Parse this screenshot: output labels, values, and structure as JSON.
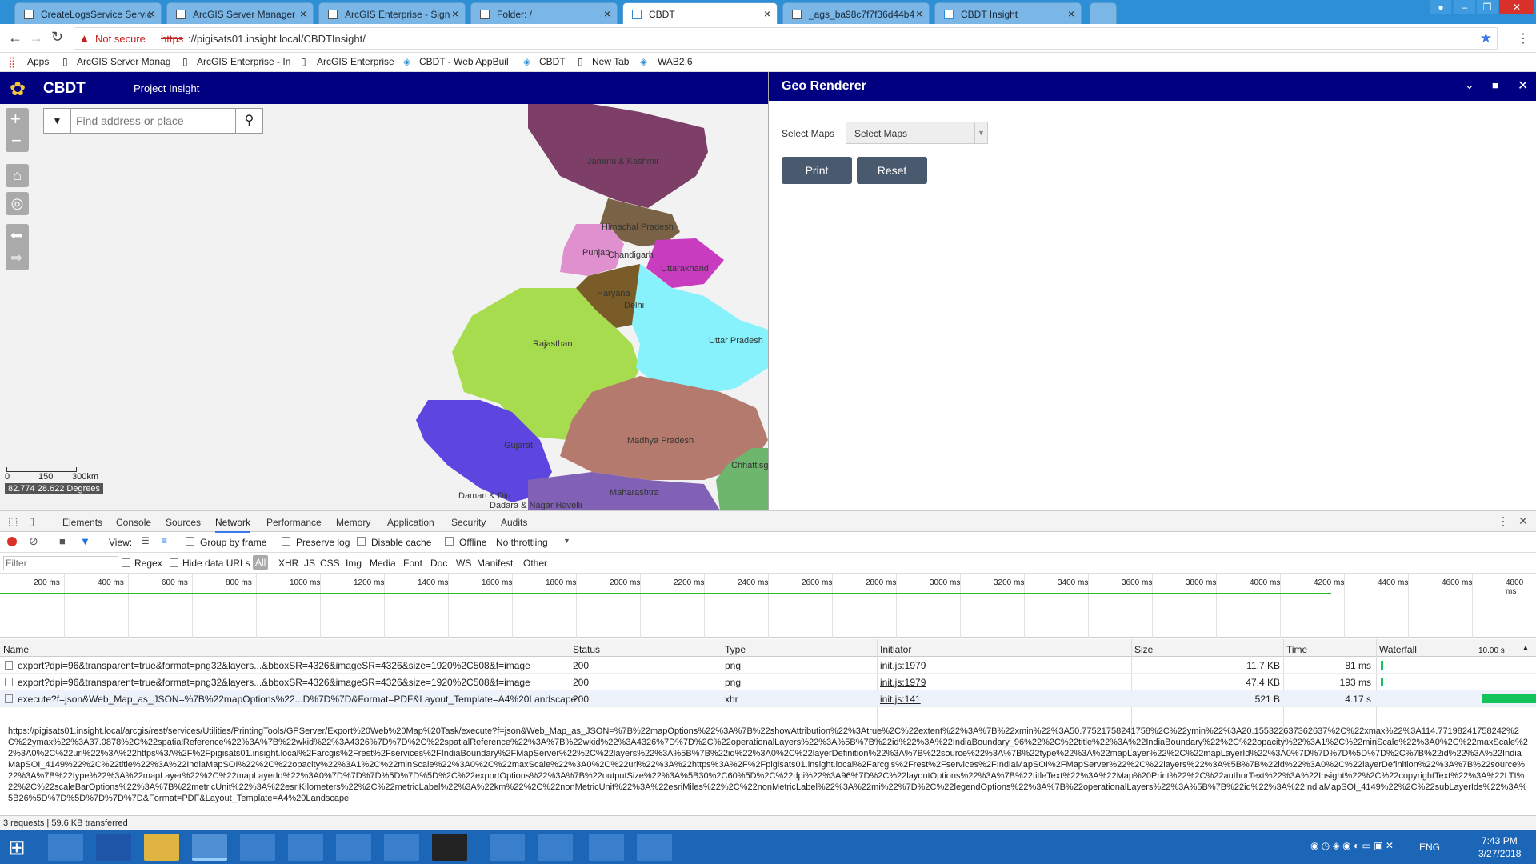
{
  "browser": {
    "tabs": [
      {
        "title": "CreateLogsService Servic"
      },
      {
        "title": "ArcGIS Server Manager"
      },
      {
        "title": "ArcGIS Enterprise - Sign"
      },
      {
        "title": "Folder: /"
      },
      {
        "title": "CBDT"
      },
      {
        "title": "_ags_ba98c7f7f36d44b4"
      },
      {
        "title": "CBDT Insight"
      }
    ],
    "not_secure": "Not secure",
    "url_scheme": "https",
    "url_rest": "://pigisats01.insight.local/CBDTInsight/",
    "bookmarks": [
      "Apps",
      "ArcGIS Server Manag",
      "ArcGIS Enterprise - In",
      "ArcGIS Enterprise",
      "CBDT - Web AppBuil",
      "CBDT",
      "New Tab",
      "WAB2.6"
    ]
  },
  "app": {
    "title": "CBDT",
    "subtitle": "Project Insight",
    "search_placeholder": "Find address or place",
    "scale_labels": [
      "0",
      "150",
      "300km"
    ],
    "coords": "82.774 28.622 Degrees",
    "states": [
      "Jammu & Kashmir",
      "Himachal Pradesh",
      "Punjab",
      "Chandigarh",
      "Uttarakhand",
      "Haryana",
      "Delhi",
      "Rajasthan",
      "Uttar Pradesh",
      "Gujarat",
      "Madhya Pradesh",
      "Chhattisg",
      "Maharashtra",
      "Daman & Diu",
      "Dadara & Nagar Havelli"
    ]
  },
  "panel": {
    "title": "Geo Renderer",
    "select_label": "Select Maps",
    "select_value": "Select Maps",
    "print": "Print",
    "reset": "Reset"
  },
  "devtools": {
    "tabs": [
      "Elements",
      "Console",
      "Sources",
      "Network",
      "Performance",
      "Memory",
      "Application",
      "Security",
      "Audits"
    ],
    "toolbar": {
      "view": "View:",
      "group": "Group by frame",
      "preserve": "Preserve log",
      "disable_cache": "Disable cache",
      "offline": "Offline",
      "throttle": "No throttling"
    },
    "filter_placeholder": "Filter",
    "filter_opts": [
      "Regex",
      "Hide data URLs"
    ],
    "types": [
      "All",
      "XHR",
      "JS",
      "CSS",
      "Img",
      "Media",
      "Font",
      "Doc",
      "WS",
      "Manifest",
      "Other"
    ],
    "ticks": [
      "200 ms",
      "400 ms",
      "600 ms",
      "800 ms",
      "1000 ms",
      "1200 ms",
      "1400 ms",
      "1600 ms",
      "1800 ms",
      "2000 ms",
      "2200 ms",
      "2400 ms",
      "2600 ms",
      "2800 ms",
      "3000 ms",
      "3200 ms",
      "3400 ms",
      "3600 ms",
      "3800 ms",
      "4000 ms",
      "4200 ms",
      "4400 ms",
      "4600 ms",
      "4800 ms"
    ],
    "columns": [
      "Name",
      "Status",
      "Type",
      "Initiator",
      "Size",
      "Time",
      "Waterfall"
    ],
    "waterfall_scale": "10.00 s",
    "rows": [
      {
        "name": "export?dpi=96&transparent=true&format=png32&layers...&bboxSR=4326&imageSR=4326&size=1920%2C508&f=image",
        "status": "200",
        "type": "png",
        "initiator": "init.js:1979",
        "size": "11.7 KB",
        "time": "81 ms"
      },
      {
        "name": "export?dpi=96&transparent=true&format=png32&layers...&bboxSR=4326&imageSR=4326&size=1920%2C508&f=image",
        "status": "200",
        "type": "png",
        "initiator": "init.js:1979",
        "size": "47.4 KB",
        "time": "193 ms"
      },
      {
        "name": "execute?f=json&Web_Map_as_JSON=%7B%22mapOptions%22...D%7D%7D&Format=PDF&Layout_Template=A4%20Landscape",
        "status": "200",
        "type": "xhr",
        "initiator": "init.js:141",
        "size": "521 B",
        "time": "4.17 s"
      }
    ],
    "tooltip_url": "https://pigisats01.insight.local/arcgis/rest/services/Utilities/PrintingTools/GPServer/Export%20Web%20Map%20Task/execute?f=json&Web_Map_as_JSON=%7B%22mapOptions%22%3A%7B%22showAttribution%22%3Atrue%2C%22extent%22%3A%7B%22xmin%22%3A50.77521758241758%2C%22ymin%22%3A20.155322637362637%2C%22xmax%22%3A114.77198241758242%2C%22ymax%22%3A37.0878%2C%22spatialReference%22%3A%7B%22wkid%22%3A4326%7D%7D%2C%22spatialReference%22%3A%7B%22wkid%22%3A4326%7D%7D%2C%22operationalLayers%22%3A%5B%7B%22id%22%3A%22IndiaBoundary_96%22%2C%22title%22%3A%22IndiaBoundary%22%2C%22opacity%22%3A1%2C%22minScale%22%3A0%2C%22maxScale%22%3A0%2C%22url%22%3A%22https%3A%2F%2Fpigisats01.insight.local%2Farcgis%2Frest%2Fservices%2FIndiaBoundary%2FMapServer%22%2C%22layers%22%3A%5B%7B%22id%22%3A0%2C%22layerDefinition%22%3A%7B%22source%22%3A%7B%22type%22%3A%22mapLayer%22%2C%22mapLayerId%22%3A0%7D%7D%7D%5D%7D%2C%7B%22id%22%3A%22IndiaMapSOI_4149%22%2C%22title%22%3A%22IndiaMapSOI%22%2C%22opacity%22%3A1%2C%22minScale%22%3A0%2C%22maxScale%22%3A0%2C%22url%22%3A%22https%3A%2F%2Fpigisats01.insight.local%2Farcgis%2Frest%2Fservices%2FIndiaMapSOI%2FMapServer%22%2C%22layers%22%3A%5B%7B%22id%22%3A0%2C%22layerDefinition%22%3A%7B%22source%22%3A%7B%22type%22%3A%22mapLayer%22%2C%22mapLayerId%22%3A0%7D%7D%7D%5D%7D%5D%2C%22exportOptions%22%3A%7B%22outputSize%22%3A%5B30%2C60%5D%2C%22dpi%22%3A96%7D%2C%22layoutOptions%22%3A%7B%22titleText%22%3A%22Map%20Print%22%2C%22authorText%22%3A%22Insight%22%2C%22copyrightText%22%3A%22LTI%22%2C%22scaleBarOptions%22%3A%7B%22metricUnit%22%3A%22esriKilometers%22%2C%22metricLabel%22%3A%22km%22%2C%22nonMetricUnit%22%3A%22esriMiles%22%2C%22nonMetricLabel%22%3A%22mi%22%7D%2C%22legendOptions%22%3A%7B%22operationalLayers%22%3A%5B%7B%22id%22%3A%22IndiaMapSOI_4149%22%2C%22subLayerIds%22%3A%5B26%5D%7D%5D%7D%7D%7D&Format=PDF&Layout_Template=A4%20Landscape",
    "summary": "3 requests | 59.6 KB transferred"
  },
  "taskbar": {
    "time": "7:43 PM",
    "date": "3/27/2018",
    "lang": "ENG"
  }
}
